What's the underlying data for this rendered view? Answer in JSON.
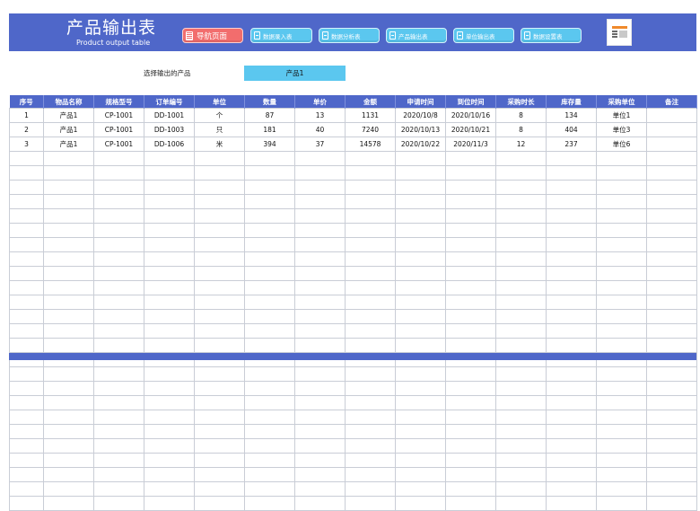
{
  "header": {
    "title_cn": "产品输出表",
    "title_en": "Product output table"
  },
  "nav": [
    {
      "label": "导航页面",
      "icon": "list-icon",
      "active": true
    },
    {
      "label": "数据录入表",
      "icon": "document-icon",
      "active": false
    },
    {
      "label": "数据分析表",
      "icon": "document-icon",
      "active": false
    },
    {
      "label": "产品输出表",
      "icon": "document-icon",
      "active": false
    },
    {
      "label": "单位输出表",
      "icon": "document-icon",
      "active": false
    },
    {
      "label": "数据设置表",
      "icon": "document-icon",
      "active": false
    }
  ],
  "selector": {
    "label": "选择输出的产品",
    "value": "产品1"
  },
  "table": {
    "columns": [
      "序号",
      "物品名称",
      "规格型号",
      "订单编号",
      "单位",
      "数量",
      "单价",
      "金额",
      "申请时间",
      "到位时间",
      "采购时长",
      "库存量",
      "采购单位",
      "备注"
    ],
    "rows": [
      [
        "1",
        "产品1",
        "CP-1001",
        "DD-1001",
        "个",
        "87",
        "13",
        "1131",
        "2020/10/8",
        "2020/10/16",
        "8",
        "134",
        "单位1",
        ""
      ],
      [
        "2",
        "产品1",
        "CP-1001",
        "DD-1003",
        "只",
        "181",
        "40",
        "7240",
        "2020/10/13",
        "2020/10/21",
        "8",
        "404",
        "单位3",
        ""
      ],
      [
        "3",
        "产品1",
        "CP-1001",
        "DD-1006",
        "米",
        "394",
        "37",
        "14578",
        "2020/10/22",
        "2020/11/3",
        "12",
        "237",
        "单位6",
        ""
      ]
    ],
    "empty_rows": 25
  },
  "colors": {
    "header_bg": "#4f67c9",
    "nav_button": "#5bc7ef",
    "nav_button_active": "#f26d6d",
    "selector_bg": "#5bc7ef"
  }
}
